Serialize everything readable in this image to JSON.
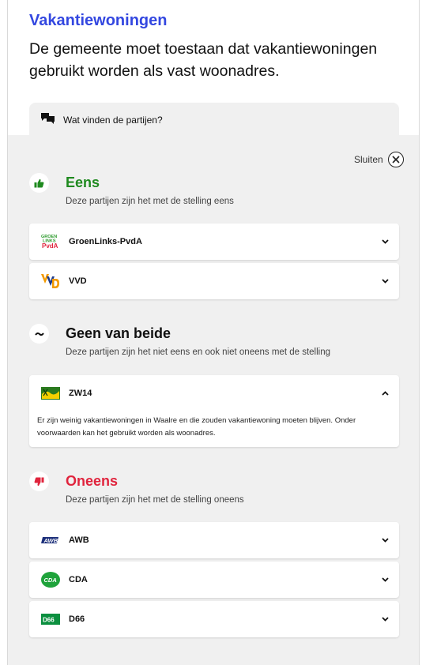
{
  "header": {
    "topic": "Vakantiewoningen",
    "statement": "De gemeente moet toestaan dat vakantiewoningen gebruikt worden als vast woonadres."
  },
  "tab": {
    "label": "Wat vinden de partijen?",
    "icon": "speech-bubbles-icon"
  },
  "close": {
    "label": "Sluiten",
    "icon": "close-icon"
  },
  "colors": {
    "accent_blue": "#3347e0",
    "agree_green": "#1f8a1f",
    "disagree_red": "#e0243d",
    "panel_bg": "#f0f0f0"
  },
  "groups": {
    "agree": {
      "title": "Eens",
      "subtitle": "Deze partijen zijn het met de stelling eens",
      "icon": "thumbs-up-icon",
      "parties": [
        {
          "name": "GroenLinks-PvdA",
          "logo_text": "GROEN LINKS PvdA",
          "expanded": false
        },
        {
          "name": "VVD",
          "logo_text": "VVD",
          "expanded": false
        }
      ]
    },
    "neutral": {
      "title": "Geen van beide",
      "subtitle": "Deze partijen zijn het niet eens en ook niet oneens met de stelling",
      "icon": "tilde-icon",
      "parties": [
        {
          "name": "ZW14",
          "expanded": true,
          "explanation": "Er zijn weinig vakantiewoningen in Waalre en die zouden vakantiewoning moeten blijven. Onder voorwaarden kan het gebruikt worden als woonadres."
        }
      ]
    },
    "disagree": {
      "title": "Oneens",
      "subtitle": "Deze partijen zijn het met de stelling oneens",
      "icon": "thumbs-down-icon",
      "parties": [
        {
          "name": "AWB",
          "logo_text": "AWB",
          "expanded": false
        },
        {
          "name": "CDA",
          "logo_text": "CDA",
          "expanded": false
        },
        {
          "name": "D66",
          "logo_text": "D66",
          "expanded": false
        }
      ]
    }
  }
}
